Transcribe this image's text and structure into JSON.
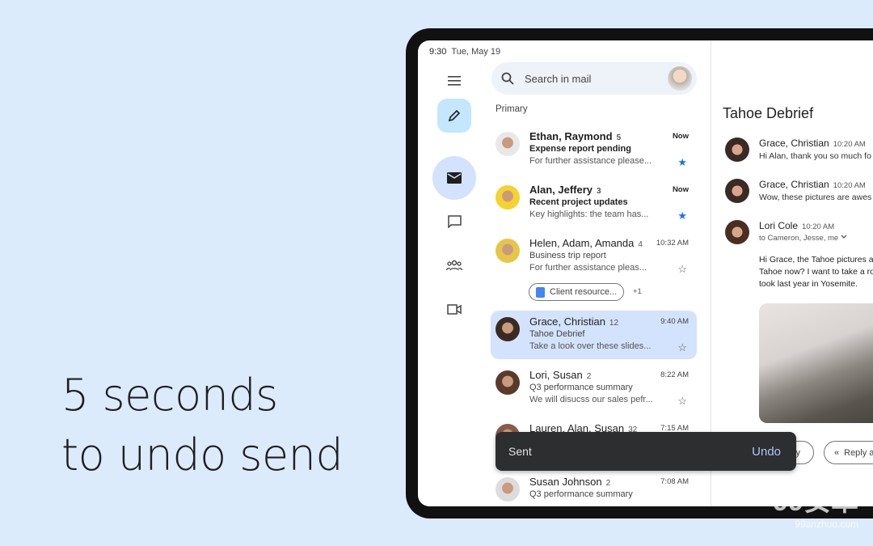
{
  "headline": {
    "line1": "5 seconds",
    "line2": "to undo send"
  },
  "status": {
    "time": "9:30",
    "date": "Tue, May 19"
  },
  "search": {
    "placeholder": "Search in mail"
  },
  "list": {
    "section": "Primary",
    "rows": [
      {
        "name": "Ethan, Raymond",
        "count": "5",
        "time": "Now",
        "subject": "Expense report pending",
        "preview": "For further assistance please...",
        "starred": true,
        "unread": true,
        "color": "#e8e8e8"
      },
      {
        "name": "Alan, Jeffery",
        "count": "3",
        "time": "Now",
        "subject": "Recent project updates",
        "preview": "Key highlights: the team has...",
        "starred": true,
        "unread": true,
        "color": "#f5d22e"
      },
      {
        "name": "Helen, Adam, Amanda",
        "count": "4",
        "time": "10:32 AM",
        "subject": "Business trip report",
        "preview": "For further assistance pleas...",
        "starred": false,
        "attachment": "Client resource...",
        "more": "+1",
        "color": "#e6c64a"
      },
      {
        "name": "Grace, Christian",
        "count": "12",
        "time": "9:40 AM",
        "subject": "Tahoe Debrief",
        "preview": "Take a look over these slides...",
        "starred": false,
        "selected": true,
        "color": "#3a2a24"
      },
      {
        "name": "Lori, Susan",
        "count": "2",
        "time": "8:22 AM",
        "subject": "Q3 performance summary",
        "preview": "We will disucss our sales pefr...",
        "starred": false,
        "color": "#5a3a2a"
      },
      {
        "name": "Lauren, Alan, Susan",
        "count": "32",
        "time": "7:15 AM",
        "subject": "",
        "preview": "",
        "color": "#8a5a4a"
      },
      {
        "name": "Susan Johnson",
        "count": "2",
        "time": "7:08 AM",
        "subject": "Q3 performance summary",
        "preview": "",
        "color": "#dcdcdc"
      }
    ]
  },
  "thread": {
    "title": "Tahoe Debrief",
    "messages": [
      {
        "from": "Grace, Christian",
        "time": "10:20 AM",
        "text": "Hi Alan, thank you so much fo"
      },
      {
        "from": "Grace, Christian",
        "time": "10:20 AM",
        "text": "Wow, these pictures are awes"
      },
      {
        "from": "Lori Cole",
        "time": "10:20 AM",
        "text": "to Cameron, Jesse, me"
      }
    ],
    "body": [
      "Hi Grace, the Tahoe pictures a",
      "Tahoe now? I want to take a ro",
      "took last year in Yosemite."
    ],
    "reply": "ply",
    "reply_all": "Reply a"
  },
  "snackbar": {
    "text": "Sent",
    "action": "Undo"
  },
  "watermark": {
    "text": "99安卓",
    "sub": "99anzhuo.com"
  },
  "colors": {
    "accent": "#1a73e8",
    "selected": "#d3e3fd",
    "compose": "#c2e7ff"
  }
}
